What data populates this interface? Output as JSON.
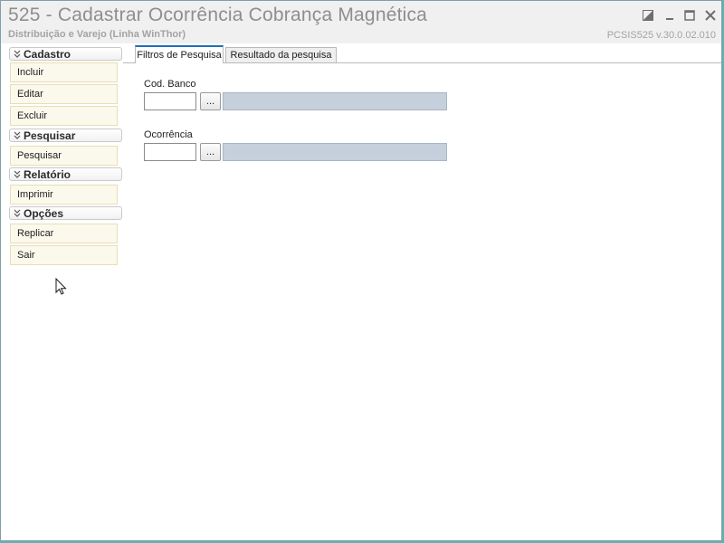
{
  "window": {
    "title": "525 - Cadastrar Ocorrência Cobrança Magnética",
    "subtitle": "Distribuição e Varejo (Linha WinThor)",
    "version": "PCSIS525  v.30.0.02.010",
    "controls": [
      "restore-icon",
      "minimize-icon",
      "maximize-icon",
      "close-icon"
    ]
  },
  "sidebar": {
    "sections": [
      {
        "title": "Cadastro",
        "items": [
          "Incluir",
          "Editar",
          "Excluir"
        ]
      },
      {
        "title": "Pesquisar",
        "items": [
          "Pesquisar"
        ]
      },
      {
        "title": "Relatório",
        "items": [
          "Imprimir"
        ]
      },
      {
        "title": "Opções",
        "items": [
          "Replicar",
          "Sair"
        ]
      }
    ]
  },
  "tabs": {
    "items": [
      "Filtros de Pesquisa",
      "Resultado da pesquisa"
    ],
    "active": "Filtros de Pesquisa"
  },
  "filters": {
    "cod_banco": {
      "label": "Cod. Banco",
      "value": "",
      "lookup_label": "...",
      "description": ""
    },
    "ocorrencia": {
      "label": "Ocorrência",
      "value": "",
      "lookup_label": "...",
      "description": ""
    }
  },
  "colors": {
    "accent": "#1d6fb8",
    "sidebar_item_bg": "#fbf9ec",
    "sidebar_item_border": "#e8deb6",
    "description_field": "#c5d0dc",
    "desktop": "#5fb3b3"
  }
}
